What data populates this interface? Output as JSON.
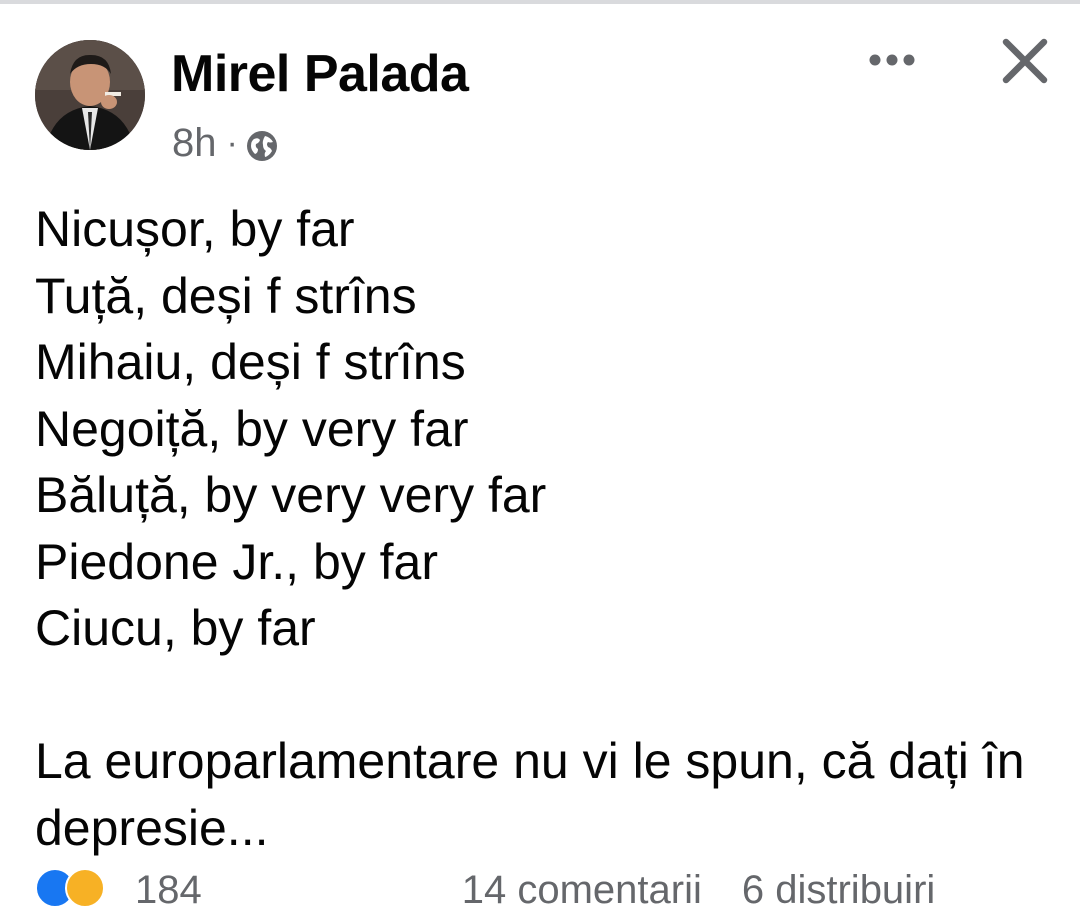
{
  "post": {
    "author": "Mirel Palada",
    "time": "8h",
    "separator": "·",
    "audience_icon": "globe-icon",
    "lines": [
      "Nicușor, by far",
      "Tuță, deși f strîns",
      "Mihaiu, deși f strîns",
      "Negoiță, by very far",
      "Băluță, by very very far",
      "Piedone Jr., by far",
      "Ciucu, by far"
    ],
    "closing": "La europarlamentare nu vi le spun, că dați în depresie..."
  },
  "footer": {
    "reaction_count": "184",
    "comments": "14 comentarii",
    "shares": "6 distribuiri"
  },
  "colors": {
    "text": "#050505",
    "secondary": "#65676b",
    "like_blue": "#1877f2"
  }
}
